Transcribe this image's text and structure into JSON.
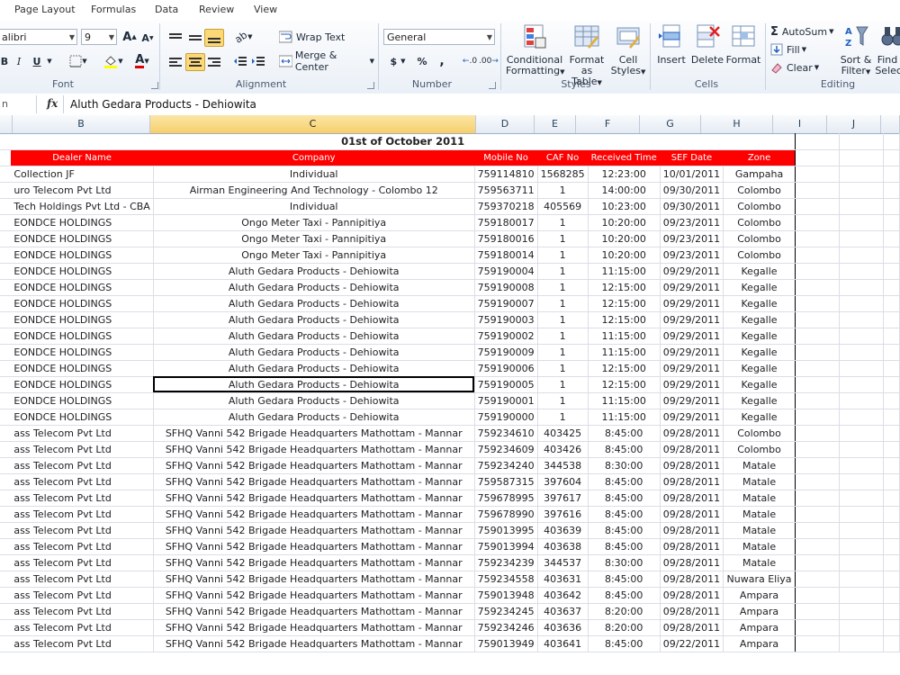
{
  "tabs": [
    "Page Layout",
    "Formulas",
    "Data",
    "Review",
    "View"
  ],
  "ribbon": {
    "font_name": "alibri",
    "font_size": "9",
    "grow_font": "A",
    "shrink_font": "A",
    "bold": "B",
    "italic": "I",
    "underline": "U",
    "font_color_letter": "A",
    "wrap_text": "Wrap Text",
    "merge_center": "Merge & Center",
    "number_format": "General",
    "currency": "$",
    "percent": "%",
    "comma": ",",
    "inc_decimal": ".0",
    "dec_decimal": ".00",
    "conditional_formatting": [
      "Conditional",
      "Formatting"
    ],
    "format_as_table": [
      "Format",
      "as Table"
    ],
    "cell_styles": [
      "Cell",
      "Styles"
    ],
    "insert": "Insert",
    "delete": "Delete",
    "format": "Format",
    "autosum": "AutoSum",
    "fill": "Fill",
    "clear": "Clear",
    "sort_filter": [
      "Sort &",
      "Filter"
    ],
    "find_select": [
      "Find &",
      "Select"
    ],
    "groups": {
      "font": "Font",
      "alignment": "Alignment",
      "number": "Number",
      "styles": "Styles",
      "cells": "Cells",
      "editing": "Editing"
    }
  },
  "formula_bar": {
    "name_box": "n",
    "fx": "fx",
    "content": "Aluth Gedara Products - Dehiowita"
  },
  "columns": [
    "B",
    "C",
    "D",
    "E",
    "F",
    "G",
    "H",
    "I",
    "J"
  ],
  "sheet": {
    "title": "01st of October 2011",
    "headers": [
      "Dealer Name",
      "Company",
      "Mobile No",
      "CAF No",
      "Received Time",
      "SEF Date",
      "Zone"
    ],
    "rows": [
      [
        "Collection JF",
        "Individual",
        "759114810",
        "1568285",
        "12:23:00",
        "10/01/2011",
        "Gampaha"
      ],
      [
        "uro Telecom Pvt Ltd",
        "Airman Engineering And Technology - Colombo 12",
        "759563711",
        "1",
        "14:00:00",
        "09/30/2011",
        "Colombo"
      ],
      [
        "Tech Holdings Pvt Ltd - CBA",
        "Individual",
        "759370218",
        "405569",
        "10:23:00",
        "09/30/2011",
        "Colombo"
      ],
      [
        "EONDCE HOLDINGS",
        "Ongo Meter Taxi - Pannipitiya",
        "759180017",
        "1",
        "10:20:00",
        "09/23/2011",
        "Colombo"
      ],
      [
        "EONDCE HOLDINGS",
        "Ongo Meter Taxi - Pannipitiya",
        "759180016",
        "1",
        "10:20:00",
        "09/23/2011",
        "Colombo"
      ],
      [
        "EONDCE HOLDINGS",
        "Ongo Meter Taxi - Pannipitiya",
        "759180014",
        "1",
        "10:20:00",
        "09/23/2011",
        "Colombo"
      ],
      [
        "EONDCE HOLDINGS",
        "Aluth Gedara Products - Dehiowita",
        "759190004",
        "1",
        "11:15:00",
        "09/29/2011",
        "Kegalle"
      ],
      [
        "EONDCE HOLDINGS",
        "Aluth Gedara Products - Dehiowita",
        "759190008",
        "1",
        "12:15:00",
        "09/29/2011",
        "Kegalle"
      ],
      [
        "EONDCE HOLDINGS",
        "Aluth Gedara Products - Dehiowita",
        "759190007",
        "1",
        "12:15:00",
        "09/29/2011",
        "Kegalle"
      ],
      [
        "EONDCE HOLDINGS",
        "Aluth Gedara Products - Dehiowita",
        "759190003",
        "1",
        "12:15:00",
        "09/29/2011",
        "Kegalle"
      ],
      [
        "EONDCE HOLDINGS",
        "Aluth Gedara Products - Dehiowita",
        "759190002",
        "1",
        "11:15:00",
        "09/29/2011",
        "Kegalle"
      ],
      [
        "EONDCE HOLDINGS",
        "Aluth Gedara Products - Dehiowita",
        "759190009",
        "1",
        "11:15:00",
        "09/29/2011",
        "Kegalle"
      ],
      [
        "EONDCE HOLDINGS",
        "Aluth Gedara Products - Dehiowita",
        "759190006",
        "1",
        "12:15:00",
        "09/29/2011",
        "Kegalle"
      ],
      [
        "EONDCE HOLDINGS",
        "Aluth Gedara Products - Dehiowita",
        "759190005",
        "1",
        "12:15:00",
        "09/29/2011",
        "Kegalle"
      ],
      [
        "EONDCE HOLDINGS",
        "Aluth Gedara Products - Dehiowita",
        "759190001",
        "1",
        "11:15:00",
        "09/29/2011",
        "Kegalle"
      ],
      [
        "EONDCE HOLDINGS",
        "Aluth Gedara Products - Dehiowita",
        "759190000",
        "1",
        "11:15:00",
        "09/29/2011",
        "Kegalle"
      ],
      [
        "ass Telecom Pvt Ltd",
        "SFHQ Vanni 542 Brigade Headquarters Mathottam - Mannar",
        "759234610",
        "403425",
        "8:45:00",
        "09/28/2011",
        "Colombo"
      ],
      [
        "ass Telecom Pvt Ltd",
        "SFHQ Vanni 542 Brigade Headquarters Mathottam - Mannar",
        "759234609",
        "403426",
        "8:45:00",
        "09/28/2011",
        "Colombo"
      ],
      [
        "ass Telecom Pvt Ltd",
        "SFHQ Vanni 542 Brigade Headquarters Mathottam - Mannar",
        "759234240",
        "344538",
        "8:30:00",
        "09/28/2011",
        "Matale"
      ],
      [
        "ass Telecom Pvt Ltd",
        "SFHQ Vanni 542 Brigade Headquarters Mathottam - Mannar",
        "759587315",
        "397604",
        "8:45:00",
        "09/28/2011",
        "Matale"
      ],
      [
        "ass Telecom Pvt Ltd",
        "SFHQ Vanni 542 Brigade Headquarters Mathottam - Mannar",
        "759678995",
        "397617",
        "8:45:00",
        "09/28/2011",
        "Matale"
      ],
      [
        "ass Telecom Pvt Ltd",
        "SFHQ Vanni 542 Brigade Headquarters Mathottam - Mannar",
        "759678990",
        "397616",
        "8:45:00",
        "09/28/2011",
        "Matale"
      ],
      [
        "ass Telecom Pvt Ltd",
        "SFHQ Vanni 542 Brigade Headquarters Mathottam - Mannar",
        "759013995",
        "403639",
        "8:45:00",
        "09/28/2011",
        "Matale"
      ],
      [
        "ass Telecom Pvt Ltd",
        "SFHQ Vanni 542 Brigade Headquarters Mathottam - Mannar",
        "759013994",
        "403638",
        "8:45:00",
        "09/28/2011",
        "Matale"
      ],
      [
        "ass Telecom Pvt Ltd",
        "SFHQ Vanni 542 Brigade Headquarters Mathottam - Mannar",
        "759234239",
        "344537",
        "8:30:00",
        "09/28/2011",
        "Matale"
      ],
      [
        "ass Telecom Pvt Ltd",
        "SFHQ Vanni 542 Brigade Headquarters Mathottam - Mannar",
        "759234558",
        "403631",
        "8:45:00",
        "09/28/2011",
        "Nuwara Eliya"
      ],
      [
        "ass Telecom Pvt Ltd",
        "SFHQ Vanni 542 Brigade Headquarters Mathottam - Mannar",
        "759013948",
        "403642",
        "8:45:00",
        "09/28/2011",
        "Ampara"
      ],
      [
        "ass Telecom Pvt Ltd",
        "SFHQ Vanni 542 Brigade Headquarters Mathottam - Mannar",
        "759234245",
        "403637",
        "8:20:00",
        "09/28/2011",
        "Ampara"
      ],
      [
        "ass Telecom Pvt Ltd",
        "SFHQ Vanni 542 Brigade Headquarters Mathottam - Mannar",
        "759234246",
        "403636",
        "8:20:00",
        "09/28/2011",
        "Ampara"
      ],
      [
        "ass Telecom Pvt Ltd",
        "SFHQ Vanni 542 Brigade Headquarters Mathottam - Mannar",
        "759013949",
        "403641",
        "8:45:00",
        "09/22/2011",
        "Ampara"
      ]
    ]
  }
}
